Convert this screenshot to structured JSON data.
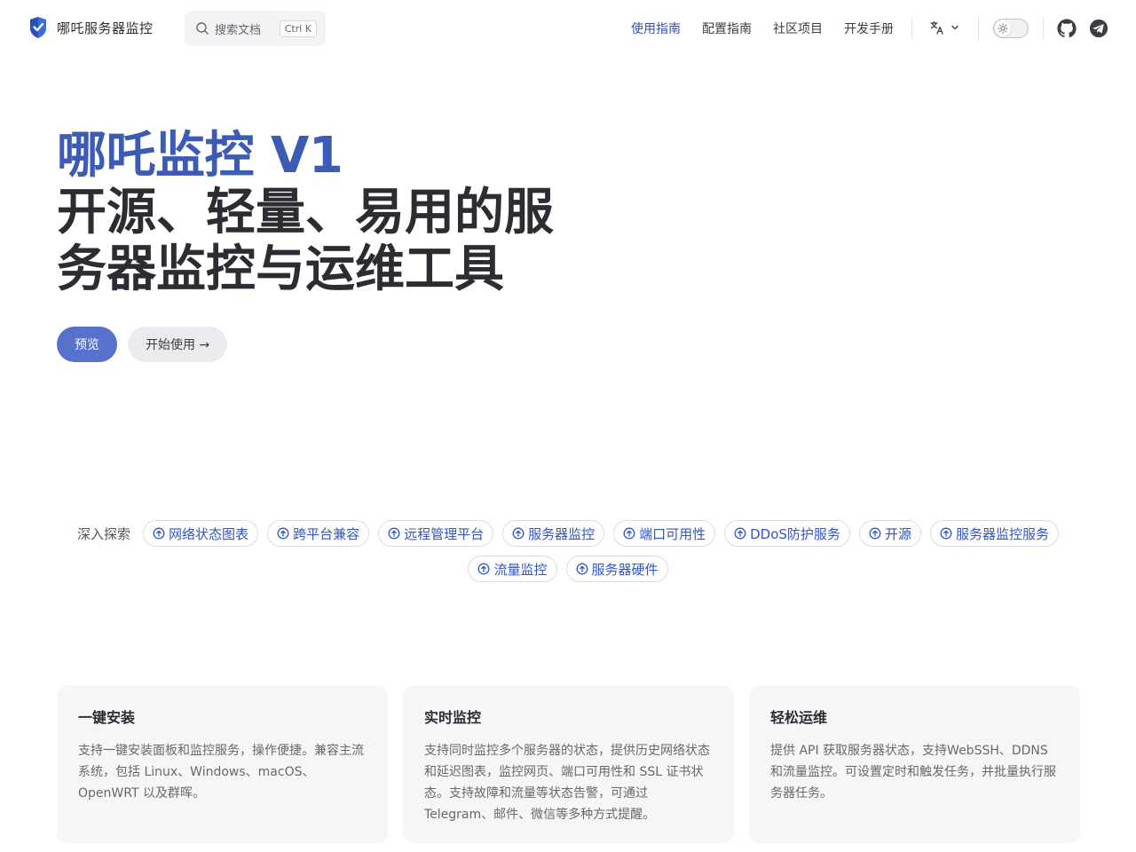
{
  "nav": {
    "brand": "哪吒服务器监控",
    "search": {
      "placeholder": "搜索文档",
      "shortcut": "Ctrl K"
    },
    "links": [
      {
        "label": "使用指南",
        "active": true
      },
      {
        "label": "配置指南",
        "active": false
      },
      {
        "label": "社区项目",
        "active": false
      },
      {
        "label": "开发手册",
        "active": false
      }
    ],
    "icons": {
      "language": "translate-icon",
      "theme": "sun-icon",
      "github": "github-icon",
      "telegram": "telegram-icon"
    }
  },
  "hero": {
    "name": "哪吒监控 V1",
    "text": "开源、轻量、易用的服务器监控与运维工具",
    "actions": [
      {
        "label": "预览",
        "theme": "brand"
      },
      {
        "label": "开始使用 →",
        "theme": "alt"
      }
    ]
  },
  "explore": {
    "label": "深入探索",
    "tags": [
      "网络状态图表",
      "跨平台兼容",
      "远程管理平台",
      "服务器监控",
      "端口可用性",
      "DDoS防护服务",
      "开源",
      "服务器监控服务",
      "流量监控",
      "服务器硬件"
    ]
  },
  "features": [
    {
      "title": "一键安装",
      "desc": "支持一键安装面板和监控服务，操作便捷。兼容主流系统，包括 Linux、Windows、macOS、OpenWRT 以及群晖。"
    },
    {
      "title": "实时监控",
      "desc": "支持同时监控多个服务器的状态，提供历史网络状态和延迟图表，监控网页、端口可用性和 SSL 证书状态。支持故障和流量等状态告警，可通过 Telegram、邮件、微信等多种方式提醒。"
    },
    {
      "title": "轻松运维",
      "desc": "提供 API 获取服务器状态，支持WebSSH、DDNS 和流量监控。可设置定时和触发任务，并批量执行服务器任务。"
    }
  ],
  "colors": {
    "brand": "#3c5bb5",
    "brand_button": "#5672cd",
    "link_active": "#3451b2",
    "tag_text": "#2f55c7"
  }
}
